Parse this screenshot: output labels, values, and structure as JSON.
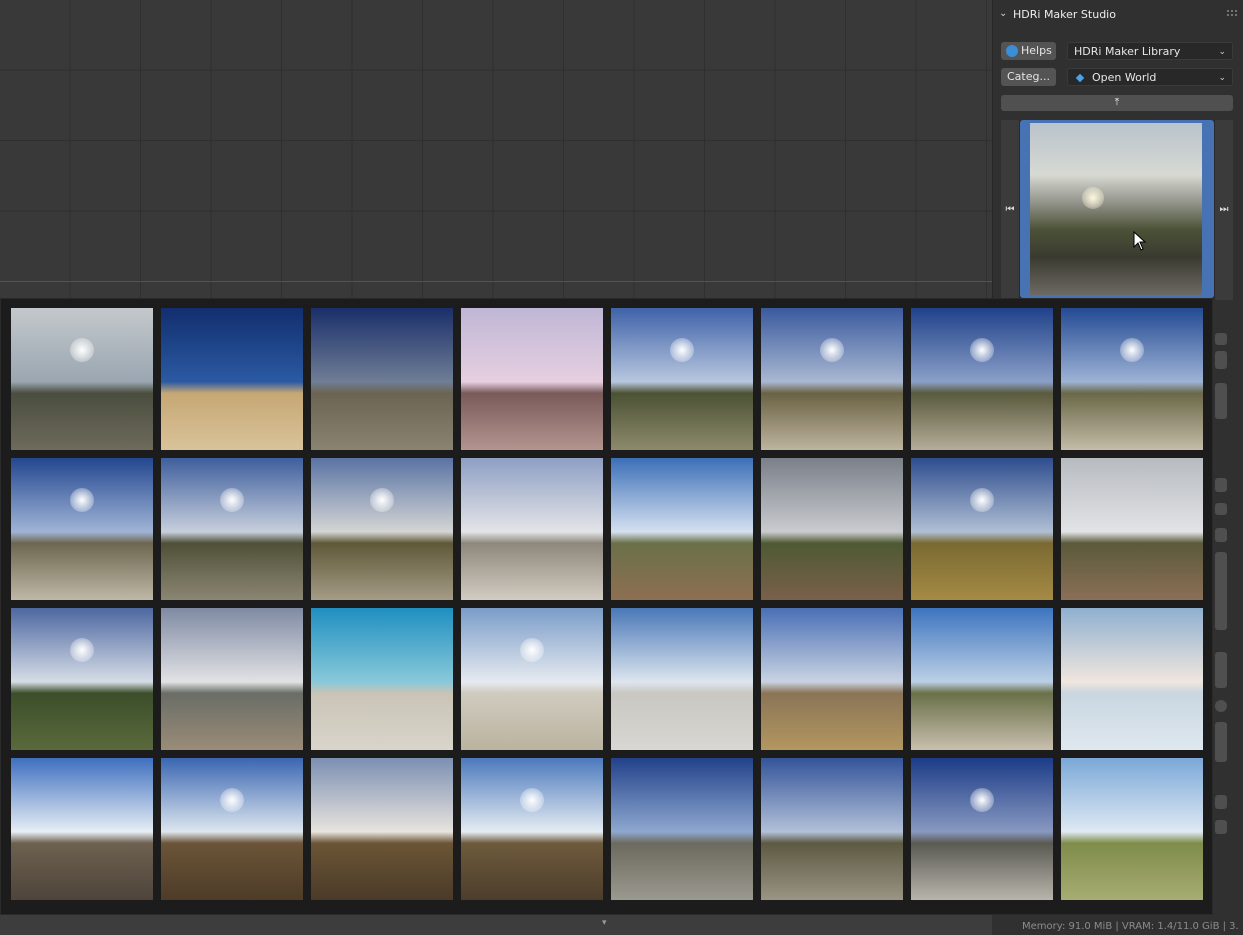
{
  "panel": {
    "title": "HDRi Maker Studio",
    "helps_label": "Helps",
    "library_select": "HDRi Maker Library",
    "category_label": "Categ...",
    "category_select": "Open World",
    "preview_icon": "preview-hdri"
  },
  "colors": {
    "accent_selection": "#4772b3",
    "x_axis": "#8a3a42",
    "popup_bg": "#1c1c1c"
  },
  "thumbnails": [
    {
      "sky": "#c4c8cc",
      "sky2": "#9aa6b1",
      "ground": "#4a4e3e",
      "ground2": "#6e6a5c",
      "sun": true
    },
    {
      "sky": "#122e6e",
      "sky2": "#2b5aa3",
      "ground": "#c6a774",
      "ground2": "#d9c39a",
      "sun": false
    },
    {
      "sky": "#1a2f6a",
      "sky2": "#6f7d95",
      "ground": "#6c6452",
      "ground2": "#8b8371",
      "sun": false
    },
    {
      "sky": "#bfb7d6",
      "sky2": "#e6cfe0",
      "ground": "#7a5a5a",
      "ground2": "#b3958f",
      "sun": false
    },
    {
      "sky": "#3f62a8",
      "sky2": "#b8c7df",
      "ground": "#4b5234",
      "ground2": "#8e8a6c",
      "sun": true
    },
    {
      "sky": "#3a5a9e",
      "sky2": "#a9b8d2",
      "ground": "#6a6244",
      "ground2": "#bdb49e",
      "sun": true
    },
    {
      "sky": "#20418a",
      "sky2": "#8aa0c8",
      "ground": "#5a5a3d",
      "ground2": "#b4ad9a",
      "sun": true
    },
    {
      "sky": "#234a93",
      "sky2": "#9eb3d5",
      "ground": "#6a6848",
      "ground2": "#c4bca8",
      "sun": true
    },
    {
      "sky": "#23478f",
      "sky2": "#9fb4d6",
      "ground": "#6d6650",
      "ground2": "#bfb8a6",
      "sun": true
    },
    {
      "sky": "#3e5e9d",
      "sky2": "#c7cfdc",
      "ground": "#4f5038",
      "ground2": "#8c8673",
      "sun": true
    },
    {
      "sky": "#5a73a4",
      "sky2": "#d4d5d4",
      "ground": "#5f5838",
      "ground2": "#a49c86",
      "sun": true
    },
    {
      "sky": "#8e9fc4",
      "sky2": "#e3e4e7",
      "ground": "#8e877c",
      "ground2": "#d2ccc2",
      "sun": false
    },
    {
      "sky": "#3c6fb8",
      "sky2": "#d5e0ef",
      "ground": "#6a7048",
      "ground2": "#8e6f52",
      "sun": false
    },
    {
      "sky": "#7a7f89",
      "sky2": "#c9cbcf",
      "ground": "#4e5a33",
      "ground2": "#7a604a",
      "sun": false
    },
    {
      "sky": "#2e4d8e",
      "sky2": "#b0bfd4",
      "ground": "#7a6a32",
      "ground2": "#a58a45",
      "sun": true
    },
    {
      "sky": "#b7bbc1",
      "sky2": "#e2e3e5",
      "ground": "#5b5a3a",
      "ground2": "#8b6f56",
      "sun": false
    },
    {
      "sky": "#4d67a0",
      "sky2": "#d6dde7",
      "ground": "#3c4e2a",
      "ground2": "#5a6a3c",
      "sun": true
    },
    {
      "sky": "#7f8aa3",
      "sky2": "#e1e2e4",
      "ground": "#6a6d66",
      "ground2": "#9a8c78",
      "sun": false
    },
    {
      "sky": "#1f8fc0",
      "sky2": "#88c9d9",
      "ground": "#c9c4b6",
      "ground2": "#d9d5cb",
      "sun": false
    },
    {
      "sky": "#7a9cc8",
      "sky2": "#e6eaf0",
      "ground": "#d0cbc0",
      "ground2": "#bab39f",
      "sun": true
    },
    {
      "sky": "#4a78b8",
      "sky2": "#dde5ee",
      "ground": "#c9c7c1",
      "ground2": "#d9d7d3",
      "sun": false
    },
    {
      "sky": "#4a6fb5",
      "sky2": "#c9d3e2",
      "ground": "#8a7456",
      "ground2": "#b39760",
      "sun": false
    },
    {
      "sky": "#3d74bf",
      "sky2": "#bcd0e6",
      "ground": "#6a7048",
      "ground2": "#c9bfae",
      "sun": false
    },
    {
      "sky": "#8fb0d0",
      "sky2": "#f0e6de",
      "ground": "#c9d6e0",
      "ground2": "#dfe8ef",
      "sun": false
    },
    {
      "sky": "#3f6fbf",
      "sky2": "#e7eef5",
      "ground": "#6d6150",
      "ground2": "#4e443a",
      "sun": false
    },
    {
      "sky": "#3a66b1",
      "sky2": "#dde6ef",
      "ground": "#6b5438",
      "ground2": "#4e3c28",
      "sun": true
    },
    {
      "sky": "#7b8fb2",
      "sky2": "#e8e4de",
      "ground": "#6b5536",
      "ground2": "#4a3a28",
      "sun": false
    },
    {
      "sky": "#4c79bd",
      "sky2": "#e5ecf2",
      "ground": "#6e5a3c",
      "ground2": "#4c3e2c",
      "sun": true
    },
    {
      "sky": "#22418a",
      "sky2": "#8ea8cf",
      "ground": "#6c6a5e",
      "ground2": "#9b9a90",
      "sun": false
    },
    {
      "sky": "#34549a",
      "sky2": "#b2c0d8",
      "ground": "#5d5a42",
      "ground2": "#9a9484",
      "sun": false
    },
    {
      "sky": "#1c3c88",
      "sky2": "#8898c0",
      "ground": "#5a5a52",
      "ground2": "#b8b5ac",
      "sun": true
    },
    {
      "sky": "#7aa8d8",
      "sky2": "#dfe9f3",
      "ground": "#7f8c4a",
      "ground2": "#a7ad72",
      "sun": false
    }
  ],
  "status": {
    "memory_text": "Memory: 91.0 MiB | VRAM: 1.4/11.0 GiB | 3."
  },
  "popup": {
    "more_arrow": "▾"
  }
}
